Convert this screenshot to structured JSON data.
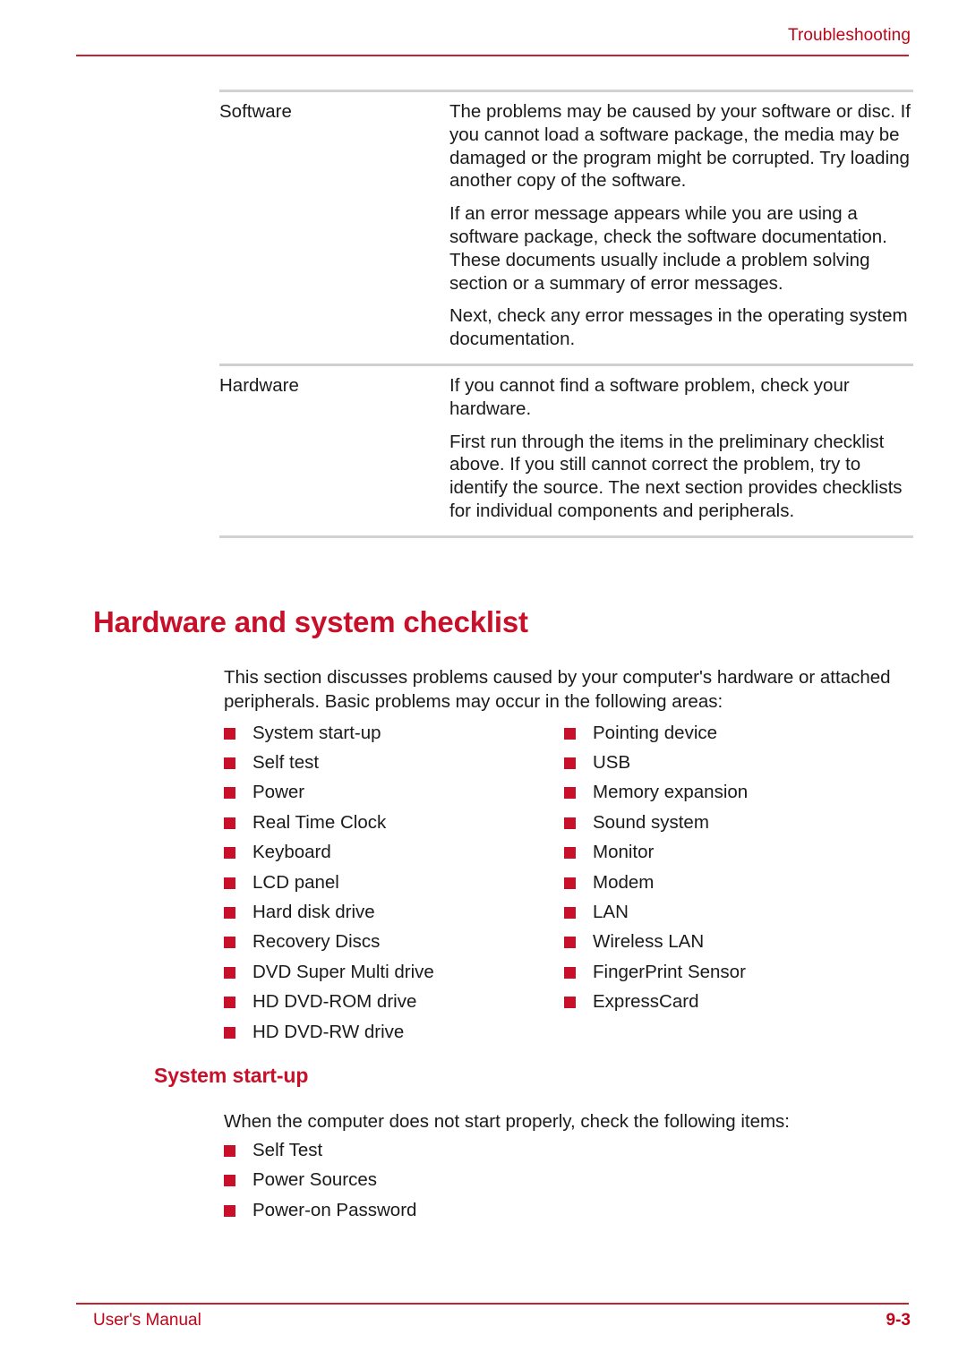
{
  "header": {
    "chapter_title": "Troubleshooting"
  },
  "table": {
    "rows": [
      {
        "label": "Software",
        "paragraphs": [
          "The problems may be caused by your software or disc. If you cannot load a software package, the media may be damaged or the program might be corrupted. Try loading another copy of the software.",
          "If an error message appears while you are using a software package, check the software documentation. These documents usually include a problem solving section or a summary of error messages.",
          "Next, check any error messages in the operating system documentation."
        ]
      },
      {
        "label": "Hardware",
        "paragraphs": [
          "If you cannot find a software problem, check your hardware.",
          "First run through the items in the preliminary checklist above. If you still cannot correct the problem, try to identify the source. The next section provides checklists for individual components and peripherals."
        ]
      }
    ]
  },
  "section": {
    "heading": "Hardware and system checklist",
    "intro": "This section discusses problems caused by your computer's hardware or attached peripherals. Basic problems may occur in the following areas:",
    "checklist_left": [
      "System start-up",
      "Self test",
      "Power",
      "Real Time Clock",
      "Keyboard",
      "LCD panel",
      "Hard disk drive",
      "Recovery Discs",
      "DVD Super Multi drive",
      "HD DVD-ROM drive",
      "HD DVD-RW drive"
    ],
    "checklist_right": [
      "Pointing device",
      "USB",
      "Memory expansion",
      "Sound system",
      "Monitor",
      "Modem",
      "LAN",
      "Wireless LAN",
      "FingerPrint Sensor",
      "ExpressCard"
    ]
  },
  "subsection": {
    "heading": "System start-up",
    "intro": "When the computer does not start properly, check the following items:",
    "items": [
      "Self Test",
      "Power Sources",
      "Power-on Password"
    ]
  },
  "footer": {
    "manual_label": "User's Manual",
    "page_number": "9-3"
  },
  "colors": {
    "accent_red": "#c8102a",
    "rule_red": "#c62230",
    "text_black": "#1a1a1a",
    "table_rule_gray": "#d2d2d2"
  }
}
